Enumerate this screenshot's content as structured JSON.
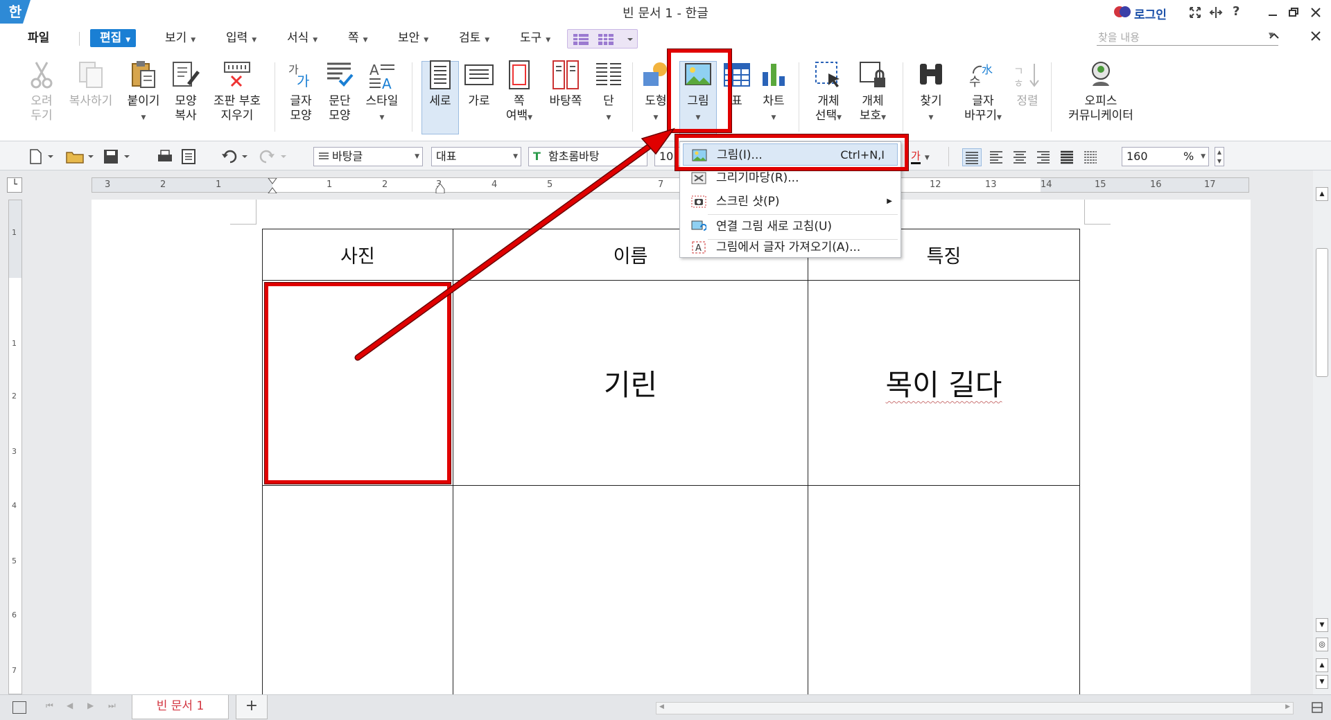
{
  "window": {
    "title": "빈 문서 1 - 한글",
    "logo": "한"
  },
  "titlebar_right": {
    "login": "로그인",
    "help": "?"
  },
  "menus": [
    {
      "label": "파일"
    },
    {
      "label": "편집"
    },
    {
      "label": "보기"
    },
    {
      "label": "입력"
    },
    {
      "label": "서식"
    },
    {
      "label": "쪽"
    },
    {
      "label": "보안"
    },
    {
      "label": "검토"
    },
    {
      "label": "도구"
    }
  ],
  "search": {
    "placeholder": "찾을 내용"
  },
  "ribbon": {
    "cut": {
      "line1": "오려",
      "line2": "두기"
    },
    "copy": {
      "line1": "복사하기"
    },
    "paste": {
      "line1": "붙이기"
    },
    "format_copy": {
      "line1": "모양",
      "line2": "복사"
    },
    "clear_marks": {
      "line1": "조판 부호",
      "line2": "지우기"
    },
    "char_shape": {
      "line1": "글자",
      "line2": "모양"
    },
    "para_shape": {
      "line1": "문단",
      "line2": "모양"
    },
    "style": {
      "line1": "스타일"
    },
    "portrait": {
      "line1": "세로"
    },
    "landscape": {
      "line1": "가로"
    },
    "margins": {
      "line1": "쪽",
      "line2": "여백"
    },
    "background_page": {
      "line1": "바탕쪽"
    },
    "columns": {
      "line1": "단"
    },
    "shapes": {
      "line1": "도형"
    },
    "picture": {
      "line1": "그림"
    },
    "table": {
      "line1": "표"
    },
    "chart": {
      "line1": "차트"
    },
    "select_object": {
      "line1": "개체",
      "line2": "선택"
    },
    "protect_object": {
      "line1": "개체",
      "line2": "보호"
    },
    "find": {
      "line1": "찾기"
    },
    "replace": {
      "line1": "글자",
      "line2": "바꾸기"
    },
    "sort": {
      "line1": "정렬"
    },
    "office_communicator": {
      "line1": "오피스",
      "line2": "커뮤니케이터"
    }
  },
  "toolbar": {
    "style_select": "바탕글",
    "lang_select": "대표",
    "font_select": "함초롬바탕",
    "font_size": "10",
    "char_color_glyph": "가",
    "zoom_value": "160",
    "zoom_unit": "%"
  },
  "ruler": {
    "ticks": [
      "3",
      "2",
      "1",
      "1",
      "2",
      "3",
      "4",
      "5",
      "7",
      "12",
      "13",
      "14",
      "15",
      "16",
      "17"
    ]
  },
  "vruler": {
    "ticks": [
      "1",
      "2",
      "3",
      "4",
      "5",
      "6",
      "7"
    ]
  },
  "dropdown": {
    "items": [
      {
        "label": "그림(I)...",
        "shortcut": "Ctrl+N,I"
      },
      {
        "label": "그리기마당(R)..."
      },
      {
        "label": "스크린 샷(P)"
      },
      {
        "label": "연결 그림 새로 고침(U)"
      },
      {
        "label": "그림에서 글자 가져오기(A)..."
      }
    ]
  },
  "document_table": {
    "headers": [
      "사진",
      "이름",
      "특징"
    ],
    "rows": [
      [
        "",
        "기린",
        "목이 길다"
      ],
      [
        "",
        "",
        ""
      ]
    ]
  },
  "statusbar": {
    "tab_label": "빈 문서 1",
    "add_tab": "+"
  },
  "colors": {
    "accent": "#1a7fd4",
    "annotation": "#e00000",
    "tab_text": "#d2343f"
  }
}
